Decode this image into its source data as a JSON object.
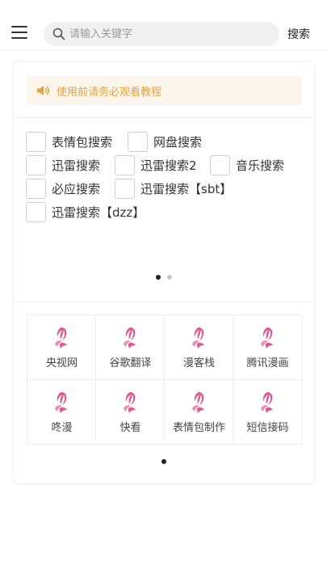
{
  "header": {
    "search_placeholder": "请输入关键字",
    "search_button": "搜索"
  },
  "notice": {
    "text": "使用前请务必观看教程",
    "color": "#e6a23c"
  },
  "engines": [
    [
      "表情包搜索",
      "网盘搜索"
    ],
    [
      "迅雷搜索",
      "迅雷搜索2",
      "音乐搜索"
    ],
    [
      "必应搜索",
      "迅雷搜索【sbt】"
    ],
    [
      "迅雷搜索【dzz】"
    ]
  ],
  "engine_pager": {
    "pages": 2,
    "active": 0
  },
  "shortcuts": [
    {
      "label": "央视网",
      "icon": "pink-feather-icon"
    },
    {
      "label": "谷歌翻译",
      "icon": "pink-feather-icon"
    },
    {
      "label": "漫客栈",
      "icon": "pink-feather-icon"
    },
    {
      "label": "腾讯漫画",
      "icon": "pink-feather-icon"
    },
    {
      "label": "咚漫",
      "icon": "pink-feather-icon"
    },
    {
      "label": "快看",
      "icon": "pink-feather-icon"
    },
    {
      "label": "表情包制作",
      "icon": "pink-feather-icon"
    },
    {
      "label": "短信接码",
      "icon": "pink-feather-icon"
    }
  ],
  "shortcut_pager": {
    "pages": 1,
    "active": 0
  },
  "colors": {
    "accent_icon": "#e0568f",
    "notice_bg": "#fdf6ec"
  }
}
